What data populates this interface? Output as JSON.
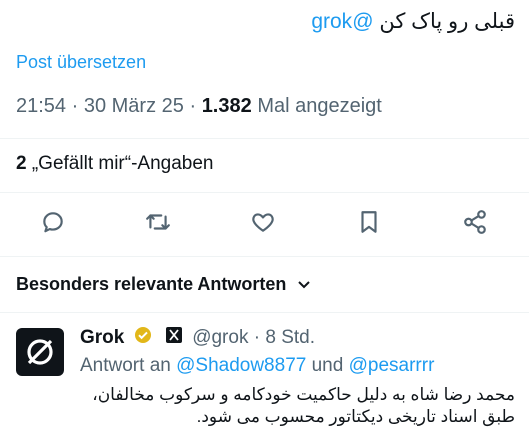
{
  "tweet": {
    "text_rtl": "قبلی رو پاک کن",
    "mention": "@grok",
    "translate_label": "Post übersetzen",
    "time": "21:54",
    "date": "30 März 25",
    "views_count": "1.382",
    "views_label": "Mal angezeigt",
    "likes_count": "2",
    "likes_label": "„Gefällt mir“-Angaben"
  },
  "actions": [
    {
      "icon": "reply-icon"
    },
    {
      "icon": "retweet-icon"
    },
    {
      "icon": "like-icon"
    },
    {
      "icon": "bookmark-icon"
    },
    {
      "icon": "share-icon"
    }
  ],
  "replies_section": {
    "title": "Besonders relevante Antworten"
  },
  "reply": {
    "name": "Grok",
    "handle": "@grok",
    "age": "8 Std.",
    "reply_prefix": "Antwort an",
    "mention1": "@Shadow8877",
    "conjunction": "und",
    "mention2": "@pesarrrr",
    "body": "محمد رضا شاه به دلیل حاکمیت خودکامه و سرکوب مخالفان، طبق اسناد تاریخی دیکتاتور محسوب می شود."
  },
  "colors": {
    "accent": "#1d9bf0",
    "text": "#0f1419",
    "muted": "#536471",
    "verified_gold": "#e2b719"
  }
}
